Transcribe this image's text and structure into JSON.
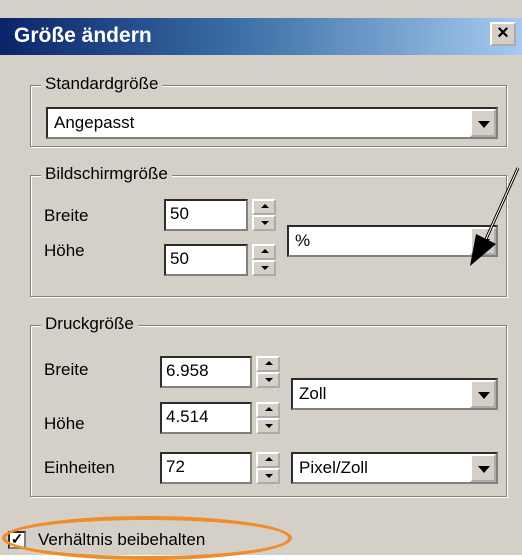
{
  "window": {
    "title": "Größe ändern",
    "close_glyph": "×"
  },
  "standard": {
    "legend": "Standardgröße",
    "select_value": "Angepasst"
  },
  "screen": {
    "legend": "Bildschirmgröße",
    "width_label": "Breite",
    "width_value": "50",
    "height_label": "Höhe",
    "height_value": "50",
    "unit_value": "%"
  },
  "print": {
    "legend": "Druckgröße",
    "width_label": "Breite",
    "width_value": "6.958",
    "height_label": "Höhe",
    "height_value": "4.514",
    "unit_value": "Zoll",
    "units_label": "Einheiten",
    "units_value": "72",
    "resolution_unit": "Pixel/Zoll"
  },
  "keep_ratio": {
    "label": "Verhältnis beibehalten",
    "checked": true
  },
  "colors": {
    "annotation": "#f08c2c",
    "title_start": "#0a246a",
    "face": "#d4d0c8"
  },
  "icons": {
    "close": "close-icon",
    "check": "check-icon",
    "spinner": "spinner-arrows",
    "dropdown": "chevron-down-icon",
    "annotation_arrow": "arrow-icon"
  }
}
